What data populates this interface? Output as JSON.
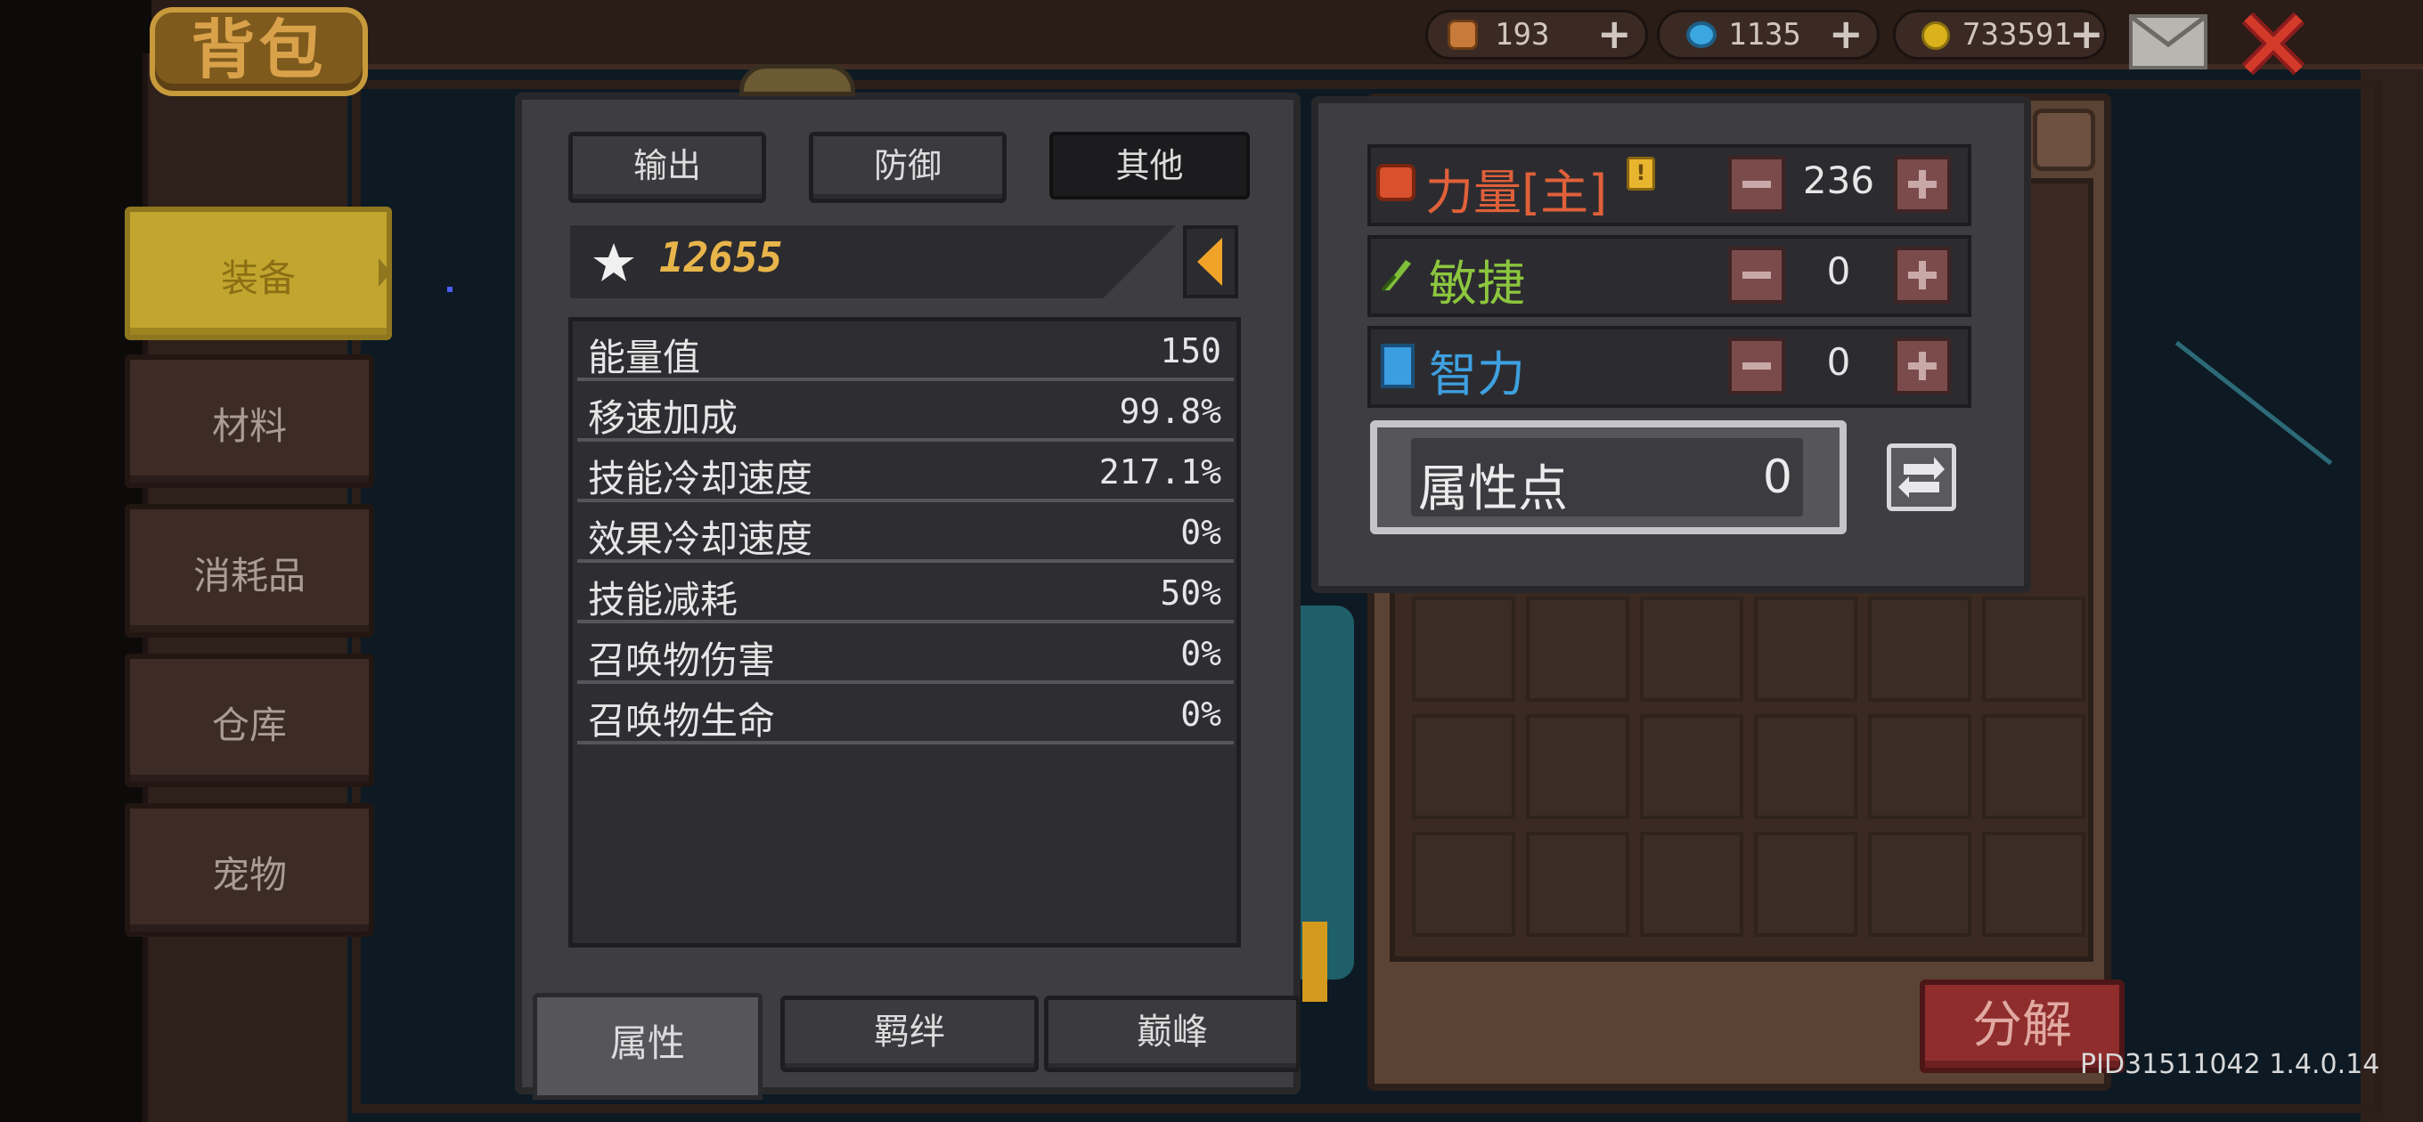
{
  "header": {
    "title": "背包",
    "currencies": [
      {
        "icon": "bottle-icon",
        "value": "193",
        "color": "#c87a3a"
      },
      {
        "icon": "gem-icon",
        "value": "1135",
        "color": "#3aa7e0"
      },
      {
        "icon": "coin-icon",
        "value": "733591",
        "color": "#d9b21c"
      }
    ],
    "mail_icon": "envelope-icon",
    "close_icon": "close-x-icon"
  },
  "sidebar": {
    "items": [
      {
        "label": "装备",
        "active": true
      },
      {
        "label": "材料",
        "active": false
      },
      {
        "label": "消耗品",
        "active": false
      },
      {
        "label": "仓库",
        "active": false
      },
      {
        "label": "宠物",
        "active": false
      }
    ]
  },
  "stats_panel": {
    "tabs": [
      {
        "label": "输出",
        "active": false
      },
      {
        "label": "防御",
        "active": false
      },
      {
        "label": "其他",
        "active": true
      }
    ],
    "score": "12655",
    "rows": [
      {
        "label": "能量值",
        "value": "150"
      },
      {
        "label": "移速加成",
        "value": "99.8%"
      },
      {
        "label": "技能冷却速度",
        "value": "217.1%"
      },
      {
        "label": "效果冷却速度",
        "value": "0%"
      },
      {
        "label": "技能减耗",
        "value": "50%"
      },
      {
        "label": "召唤物伤害",
        "value": "0%"
      },
      {
        "label": "召唤物生命",
        "value": "0%"
      }
    ],
    "bottom_tabs": [
      {
        "label": "属性",
        "active": true
      },
      {
        "label": "羁绊",
        "active": false
      },
      {
        "label": "巅峰",
        "active": false
      }
    ]
  },
  "attributes_panel": {
    "attributes": [
      {
        "label": "力量[主]",
        "value": "236",
        "color": "#e0603a",
        "icon": "fist-icon"
      },
      {
        "label": "敏捷",
        "value": "0",
        "color": "#8cc63e",
        "icon": "feather-icon"
      },
      {
        "label": "智力",
        "value": "0",
        "color": "#3ea0e0",
        "icon": "book-icon"
      }
    ],
    "points_label": "属性点",
    "points_value": "0"
  },
  "inventory": {
    "decompose_label": "分解"
  },
  "footer": {
    "version": "PID31511042 1.4.0.14"
  }
}
